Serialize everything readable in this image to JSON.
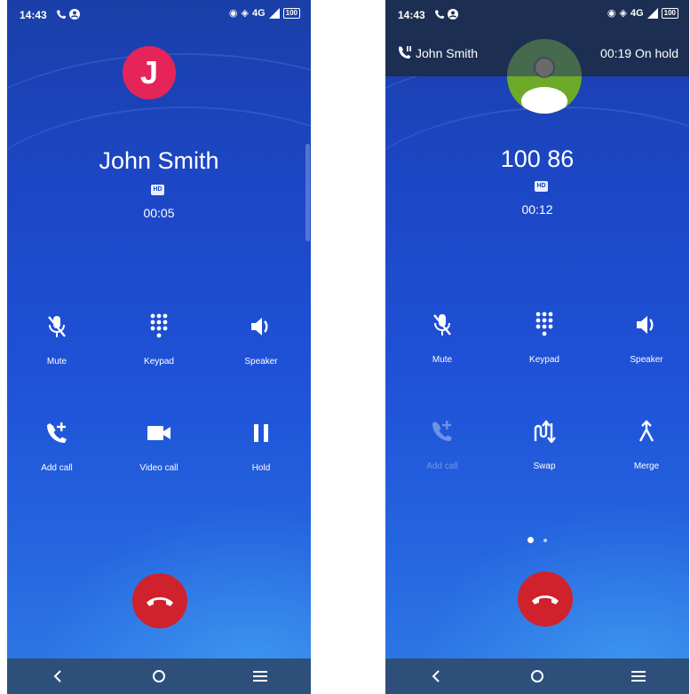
{
  "left": {
    "status": {
      "time": "14:43",
      "net": "4G",
      "battery": "100"
    },
    "avatar_letter": "J",
    "contact_name": "John Smith",
    "hd_label": "HD",
    "timer": "00:05",
    "controls": {
      "mute": "Mute",
      "keypad": "Keypad",
      "speaker": "Speaker",
      "add_call": "Add call",
      "video_call": "Video call",
      "hold": "Hold"
    }
  },
  "right": {
    "status": {
      "time": "14:43",
      "net": "4G",
      "battery": "100"
    },
    "held_call": {
      "name": "John Smith",
      "status": "00:19 On hold"
    },
    "number": "100 86",
    "hd_label": "HD",
    "timer": "00:12",
    "controls": {
      "mute": "Mute",
      "keypad": "Keypad",
      "speaker": "Speaker",
      "add_call": "Add call",
      "swap": "Swap",
      "merge": "Merge"
    },
    "page_indicator": {
      "pages": 2,
      "current": 1
    }
  },
  "colors": {
    "end_call": "#d0222c",
    "avatar": "#e5245a",
    "person_avatar": "#6eaa2a",
    "nav_bar": "#2e4f7a",
    "hold_banner": "#1c2f52"
  }
}
